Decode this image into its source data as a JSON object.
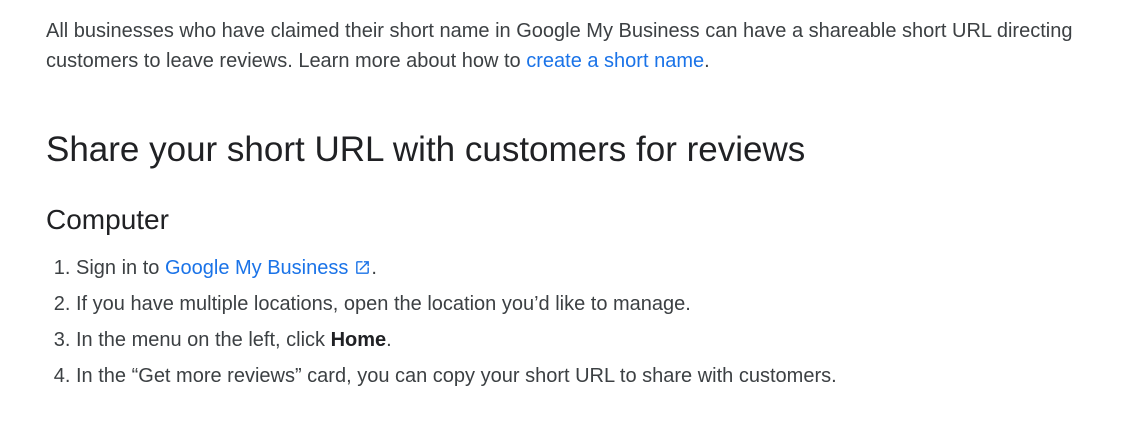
{
  "intro": {
    "text": "All businesses who have claimed their short name in Google My Business can have a shareable short URL directing customers to leave reviews. Learn more about how to ",
    "link_label": "create a short name",
    "end": "."
  },
  "section_title": "Share your short URL with customers for reviews",
  "platform_title": "Computer",
  "steps": {
    "s1_prefix": "Sign in to ",
    "s1_link": "Google My Business",
    "s1_icon": "external-link-icon",
    "s1_suffix": ".",
    "s2": "If you have multiple locations, open the location you’d like to manage.",
    "s3_prefix": "In the menu on the left, click ",
    "s3_bold": "Home",
    "s3_suffix": ".",
    "s4": "In the “Get more reviews” card, you can copy your short URL to share with customers."
  },
  "colors": {
    "link": "#1a73e8",
    "body_text": "#3c4043",
    "heading": "#202124"
  }
}
